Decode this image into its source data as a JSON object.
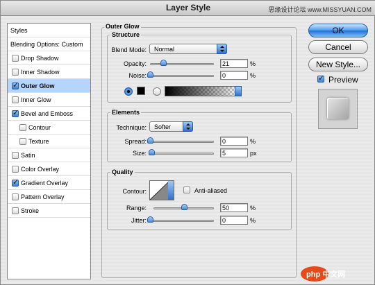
{
  "window": {
    "title": "Layer Style",
    "watermark_top": "思缘设计论坛 www.MISSYUAN.COM"
  },
  "sidebar": {
    "items": [
      {
        "label": "Styles",
        "checkbox": false,
        "checked": false,
        "selected": false,
        "indent": false,
        "header": true
      },
      {
        "label": "Blending Options: Custom",
        "checkbox": false,
        "checked": false,
        "selected": false,
        "indent": false,
        "header": true
      },
      {
        "label": "Drop Shadow",
        "checkbox": true,
        "checked": false,
        "selected": false,
        "indent": false
      },
      {
        "label": "Inner Shadow",
        "checkbox": true,
        "checked": false,
        "selected": false,
        "indent": false
      },
      {
        "label": "Outer Glow",
        "checkbox": true,
        "checked": true,
        "selected": true,
        "indent": false
      },
      {
        "label": "Inner Glow",
        "checkbox": true,
        "checked": false,
        "selected": false,
        "indent": false
      },
      {
        "label": "Bevel and Emboss",
        "checkbox": true,
        "checked": true,
        "selected": false,
        "indent": false
      },
      {
        "label": "Contour",
        "checkbox": true,
        "checked": false,
        "selected": false,
        "indent": true
      },
      {
        "label": "Texture",
        "checkbox": true,
        "checked": false,
        "selected": false,
        "indent": true
      },
      {
        "label": "Satin",
        "checkbox": true,
        "checked": false,
        "selected": false,
        "indent": false
      },
      {
        "label": "Color Overlay",
        "checkbox": true,
        "checked": false,
        "selected": false,
        "indent": false
      },
      {
        "label": "Gradient Overlay",
        "checkbox": true,
        "checked": true,
        "selected": false,
        "indent": false
      },
      {
        "label": "Pattern Overlay",
        "checkbox": true,
        "checked": false,
        "selected": false,
        "indent": false
      },
      {
        "label": "Stroke",
        "checkbox": true,
        "checked": false,
        "selected": false,
        "indent": false
      }
    ]
  },
  "outer_glow": {
    "title": "Outer Glow",
    "structure": {
      "title": "Structure",
      "blend_mode_label": "Blend Mode:",
      "blend_mode_value": "Normal",
      "opacity_label": "Opacity:",
      "opacity_value": "21",
      "opacity_level": 0.21,
      "opacity_unit": "%",
      "noise_label": "Noise:",
      "noise_value": "0",
      "noise_level": 0,
      "noise_unit": "%",
      "color_swatch": "#000000"
    },
    "elements": {
      "title": "Elements",
      "technique_label": "Technique:",
      "technique_value": "Softer",
      "spread_label": "Spread:",
      "spread_value": "0",
      "spread_level": 0,
      "spread_unit": "%",
      "size_label": "Size:",
      "size_value": "5",
      "size_level": 0.02,
      "size_unit": "px"
    },
    "quality": {
      "title": "Quality",
      "contour_label": "Contour:",
      "anti_aliased_label": "Anti-aliased",
      "anti_aliased_checked": false,
      "range_label": "Range:",
      "range_value": "50",
      "range_level": 0.5,
      "range_unit": "%",
      "jitter_label": "Jitter:",
      "jitter_value": "0",
      "jitter_level": 0,
      "jitter_unit": "%"
    }
  },
  "buttons": {
    "ok": "OK",
    "cancel": "Cancel",
    "new_style": "New Style...",
    "preview_label": "Preview",
    "preview_checked": true
  },
  "watermark_bottom": "php 中文网"
}
